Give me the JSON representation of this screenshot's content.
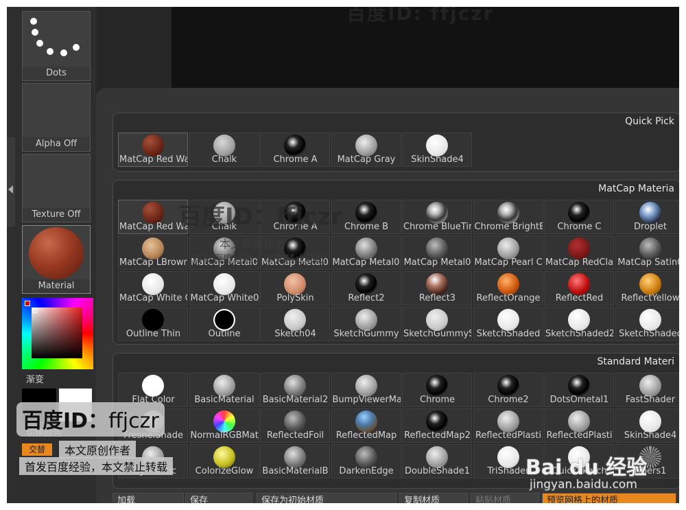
{
  "viewport": {
    "title": "百度ID: ffjczr"
  },
  "left_panel": {
    "stroke_label": "Dots",
    "alpha_label": "Alpha Off",
    "texture_label": "Texture Off",
    "material_label": "Material",
    "gradient_label": "渐变",
    "switch_label": "切换颜色",
    "swap_label": "交替"
  },
  "popup": {
    "sections": [
      {
        "title": "Quick Pick",
        "items": [
          {
            "name": "MatCap Red Wa",
            "style": "red",
            "selected": true
          },
          {
            "name": "Chalk",
            "style": "chalk"
          },
          {
            "name": "Chrome A",
            "style": "chrome"
          },
          {
            "name": "MatCap Gray",
            "style": "gray"
          },
          {
            "name": "SkinShade4",
            "style": "white"
          }
        ]
      },
      {
        "title": "MatCap Materia",
        "items": [
          {
            "name": "MatCap Red Wa",
            "style": "red",
            "selected": true
          },
          {
            "name": "Chalk",
            "style": "chalk"
          },
          {
            "name": "Chrome A",
            "style": "chrome"
          },
          {
            "name": "Chrome B",
            "style": "chrome"
          },
          {
            "name": "Chrome BlueTir",
            "style": "chromebright"
          },
          {
            "name": "Chrome BrightE",
            "style": "chromebright"
          },
          {
            "name": "Chrome C",
            "style": "chrome"
          },
          {
            "name": "Droplet",
            "style": "droplet"
          },
          {
            "name": "MatCap LBrown",
            "style": "brown"
          },
          {
            "name": "MatCap Metal0",
            "style": "metal"
          },
          {
            "name": "MatCap Metal0:",
            "style": "chrome"
          },
          {
            "name": "MatCap Metal0:",
            "style": "metal"
          },
          {
            "name": "MatCap Metal0",
            "style": "darkmetal"
          },
          {
            "name": "MatCap Pearl C",
            "style": "gray"
          },
          {
            "name": "MatCap RedClay",
            "style": "redclay"
          },
          {
            "name": "MatCap Satin0",
            "style": "darkmetal"
          },
          {
            "name": "MatCap White C",
            "style": "white"
          },
          {
            "name": "MatCap White0",
            "style": "white"
          },
          {
            "name": "PolySkin",
            "style": "skin"
          },
          {
            "name": "Reflect2",
            "style": "chrome"
          },
          {
            "name": "Reflect3",
            "style": "reflect3"
          },
          {
            "name": "ReflectOrange",
            "style": "orange"
          },
          {
            "name": "ReflectRed",
            "style": "brightred"
          },
          {
            "name": "ReflectYellow",
            "style": "yellow"
          },
          {
            "name": "Outline Thin",
            "style": "black"
          },
          {
            "name": "Outline",
            "style": "outline"
          },
          {
            "name": "Sketch04",
            "style": "sketch"
          },
          {
            "name": "SketchGummy",
            "style": "gray"
          },
          {
            "name": "SketchGummyS",
            "style": "sketch"
          },
          {
            "name": "SketchShaded",
            "style": "white"
          },
          {
            "name": "SketchShaded2",
            "style": "white"
          },
          {
            "name": "SketchShadec",
            "style": "white"
          }
        ]
      },
      {
        "title": "Standard Materi",
        "items": [
          {
            "name": "Flat Color",
            "style": "flatwhite"
          },
          {
            "name": "BasicMaterial",
            "style": "gray"
          },
          {
            "name": "BasicMaterial2",
            "style": "metal"
          },
          {
            "name": "BumpViewerMa",
            "style": "gray"
          },
          {
            "name": "Chrome",
            "style": "chrome"
          },
          {
            "name": "Chrome2",
            "style": "chrome"
          },
          {
            "name": "DotsOmetal1",
            "style": "chrome"
          },
          {
            "name": "FastShader",
            "style": "gray"
          },
          {
            "name": "FresnelShade",
            "style": "gray"
          },
          {
            "name": "NormalRGBMat",
            "style": "rgb"
          },
          {
            "name": "ReflectedFoil",
            "style": "darkmetal"
          },
          {
            "name": "ReflectedMap",
            "style": "map"
          },
          {
            "name": "ReflectedMap2",
            "style": "chrome"
          },
          {
            "name": "ReflectedPlasti",
            "style": "gray"
          },
          {
            "name": "ReflectedPlasti",
            "style": "gray"
          },
          {
            "name": "SkinShade4",
            "style": "white"
          },
          {
            "name": "Toy Plastic",
            "style": "gray"
          },
          {
            "name": "ColorizeGlow",
            "style": "glow"
          },
          {
            "name": "BasicMaterialB",
            "style": "metal"
          },
          {
            "name": "DarkenEdge",
            "style": "darkmetal"
          },
          {
            "name": "DoubleShade1",
            "style": "gray"
          },
          {
            "name": "TriShader",
            "style": "white"
          },
          {
            "name": "QuickSketch",
            "style": "white"
          },
          {
            "name": "Fibers1",
            "style": "fibers"
          }
        ]
      }
    ],
    "bottom_buttons": [
      {
        "label": "加载",
        "state": "normal"
      },
      {
        "label": "保存",
        "state": "normal"
      },
      {
        "label": "保存为初始材质",
        "state": "normal"
      },
      {
        "label": "复制材质",
        "state": "normal"
      },
      {
        "label": "粘贴材质",
        "state": "dim"
      },
      {
        "label": "预览网格上的材质",
        "state": "highlight"
      }
    ]
  },
  "watermarks": {
    "center_id": "百度ID：ffjczr",
    "center_line1": "本文原创作者",
    "center_line2": "首发百度经验，本文禁止转载",
    "bl_id_prefix": "百度ID：",
    "bl_id_name": "ffjczr",
    "bl_line1": "本文原创作者",
    "bl_line2": "首发百度经验，本文禁止转载",
    "logo": "Bai du 经验",
    "site": "jingyan.baidu.com"
  },
  "colors": {
    "accent": "#e8871e"
  }
}
